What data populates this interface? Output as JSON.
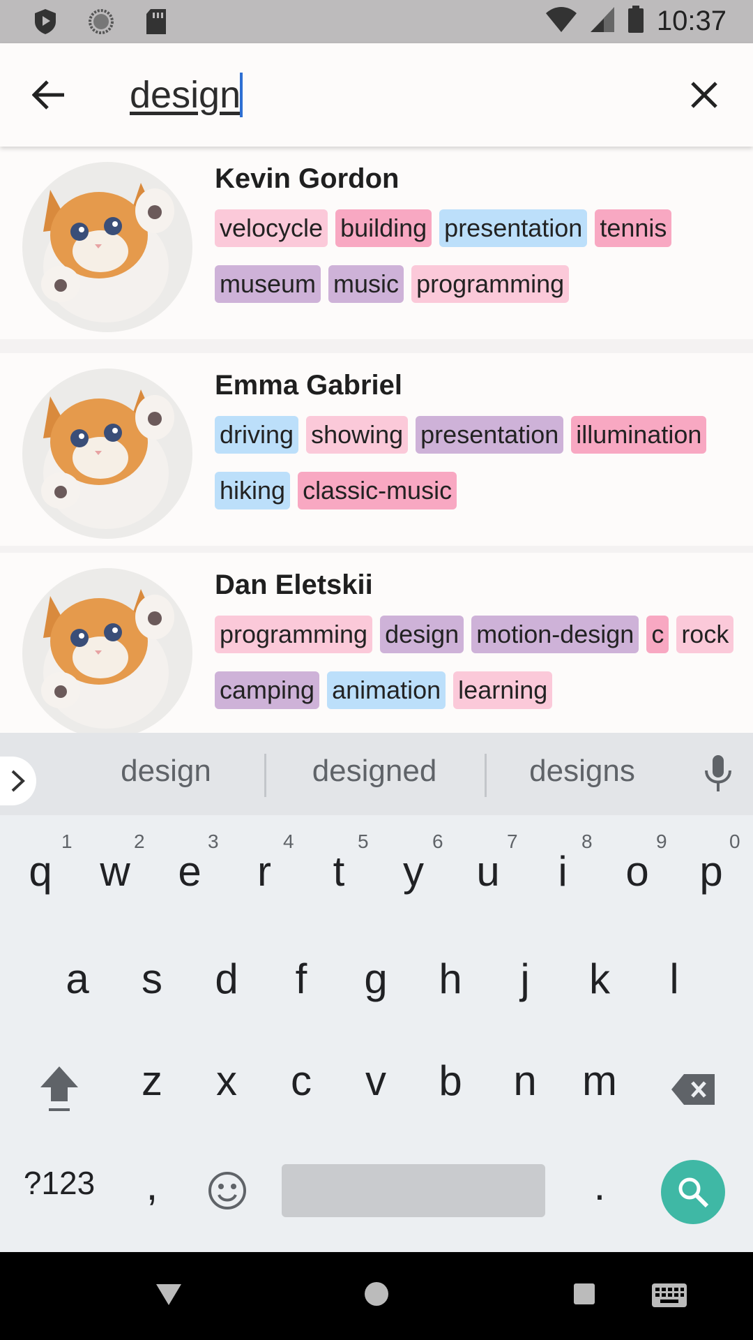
{
  "status_bar": {
    "time": "10:37",
    "icons": [
      "shield-icon",
      "sync-icon",
      "sd-card-icon",
      "wifi-icon",
      "signal-icon",
      "battery-icon"
    ]
  },
  "search": {
    "value": "design",
    "back_icon": "arrow-left-icon",
    "clear_icon": "close-icon",
    "cursor_color": "#2e6fd3"
  },
  "results": [
    {
      "name": "Kevin Gordon",
      "tags": [
        {
          "label": "velocycle",
          "color": "#fbc9d9"
        },
        {
          "label": "building",
          "color": "#f8a8c2"
        },
        {
          "label": "presentation",
          "color": "#bcdffa"
        },
        {
          "label": "tennis",
          "color": "#f8a8c2"
        },
        {
          "label": "museum",
          "color": "#ceb2d8"
        },
        {
          "label": "music",
          "color": "#ceb2d8"
        },
        {
          "label": "programming",
          "color": "#fbc9d9"
        }
      ]
    },
    {
      "name": "Emma Gabriel",
      "tags": [
        {
          "label": "driving",
          "color": "#bcdffa"
        },
        {
          "label": "showing",
          "color": "#fbc9d9"
        },
        {
          "label": "presentation",
          "color": "#ceb2d8"
        },
        {
          "label": "illumination",
          "color": "#f8a8c2"
        },
        {
          "label": "hiking",
          "color": "#bcdffa"
        },
        {
          "label": "classic-music",
          "color": "#f8a8c2"
        }
      ]
    },
    {
      "name": "Dan Eletskii",
      "tags": [
        {
          "label": "programming",
          "color": "#fbc9d9"
        },
        {
          "label": "design",
          "color": "#ceb2d8"
        },
        {
          "label": "motion-design",
          "color": "#ceb2d8"
        },
        {
          "label": "c",
          "color": "#f8a8c2"
        },
        {
          "label": "rock",
          "color": "#fbc9d9"
        },
        {
          "label": "camping",
          "color": "#ceb2d8"
        },
        {
          "label": "animation",
          "color": "#bcdffa"
        },
        {
          "label": "learning",
          "color": "#fbc9d9"
        }
      ]
    }
  ],
  "keyboard": {
    "suggestions": [
      "design",
      "designed",
      "designs"
    ],
    "row1": [
      "q",
      "w",
      "e",
      "r",
      "t",
      "y",
      "u",
      "i",
      "o",
      "p"
    ],
    "row1_numbers": [
      "1",
      "2",
      "3",
      "4",
      "5",
      "6",
      "7",
      "8",
      "9",
      "0"
    ],
    "row2": [
      "a",
      "s",
      "d",
      "f",
      "g",
      "h",
      "j",
      "k",
      "l"
    ],
    "row3": [
      "z",
      "x",
      "c",
      "v",
      "b",
      "n",
      "m"
    ],
    "symbols_key": "?123",
    "comma_key": ",",
    "period_key": ".",
    "action_color": "#3fb8a5"
  },
  "nav_bar": {
    "icons": [
      "back-triangle-icon",
      "home-circle-icon",
      "recents-square-icon",
      "keyboard-icon"
    ]
  }
}
